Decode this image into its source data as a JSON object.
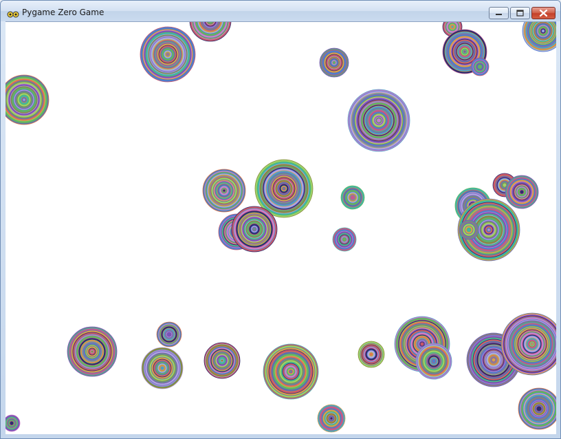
{
  "window": {
    "title": "Pygame Zero Game",
    "controls": [
      "minimize",
      "maximize",
      "close"
    ]
  },
  "game": {
    "background_color": "#ffffff",
    "ring_palette": [
      "#6b8f8a",
      "#c25b8f",
      "#4e7fd0",
      "#9bd36a",
      "#d8a04b",
      "#7a55b8",
      "#3fb6a7",
      "#c9576a",
      "#8a8a3c",
      "#5a6fb0",
      "#d07fc8",
      "#62b85c",
      "#2d2d6e",
      "#b3a3e0",
      "#e07a4b",
      "#4aa0c8"
    ],
    "icons": [
      "app-icon",
      "minimize-icon",
      "maximize-icon",
      "close-icon"
    ]
  }
}
